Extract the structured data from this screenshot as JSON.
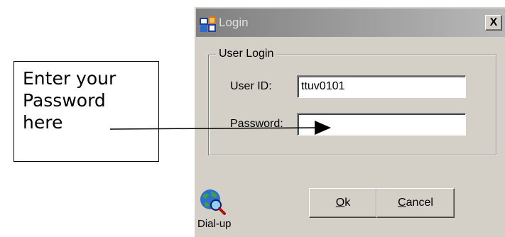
{
  "annotation": {
    "lines": [
      "Enter your",
      "Password",
      "here"
    ]
  },
  "dialog": {
    "title": "Login",
    "close_label": "X",
    "group_title": "User Login",
    "user_id_label": "User ID:",
    "user_id_value": "ttuv0101",
    "password_label": "Password:",
    "password_value": "",
    "dialup_label": "Dial-up",
    "ok_button": {
      "mnemonic": "O",
      "rest": "k"
    },
    "cancel_button": {
      "mnemonic": "C",
      "rest": "ancel"
    }
  },
  "icons": {
    "title": "login-app-icon",
    "dialup": "globe-magnifier-icon"
  },
  "colors": {
    "titlebar_inactive_start": "#808080",
    "titlebar_inactive_end": "#b8b8b8",
    "dialog_face": "#d4d0c8",
    "field_bg": "#ffffff"
  }
}
